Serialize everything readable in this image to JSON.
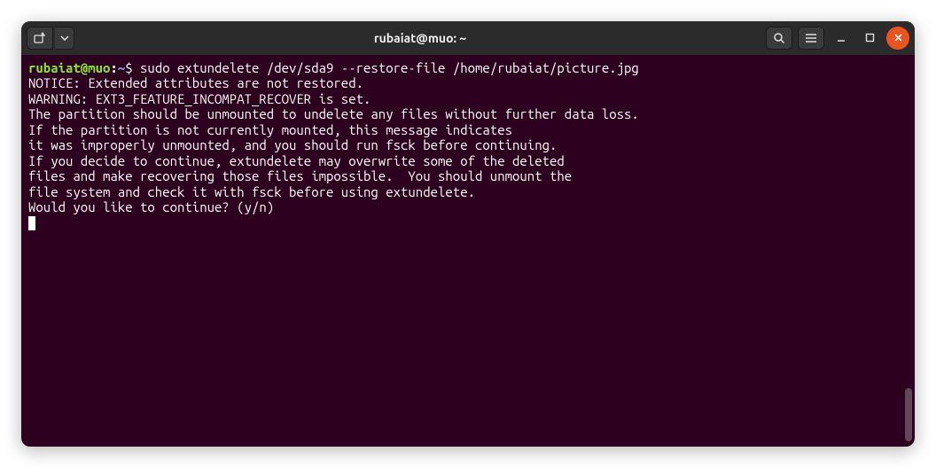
{
  "titlebar": {
    "title": "rubaiat@muo: ~"
  },
  "prompt": {
    "user_host": "rubaiat@muo",
    "separator": ":",
    "path": "~",
    "symbol": "$"
  },
  "command": " sudo extundelete /dev/sda9 --restore-file /home/rubaiat/picture.jpg",
  "output": [
    "NOTICE: Extended attributes are not restored.",
    "WARNING: EXT3_FEATURE_INCOMPAT_RECOVER is set.",
    "The partition should be unmounted to undelete any files without further data loss.",
    "If the partition is not currently mounted, this message indicates",
    "it was improperly unmounted, and you should run fsck before continuing.",
    "If you decide to continue, extundelete may overwrite some of the deleted",
    "files and make recovering those files impossible.  You should unmount the",
    "file system and check it with fsck before using extundelete.",
    "Would you like to continue? (y/n)"
  ]
}
